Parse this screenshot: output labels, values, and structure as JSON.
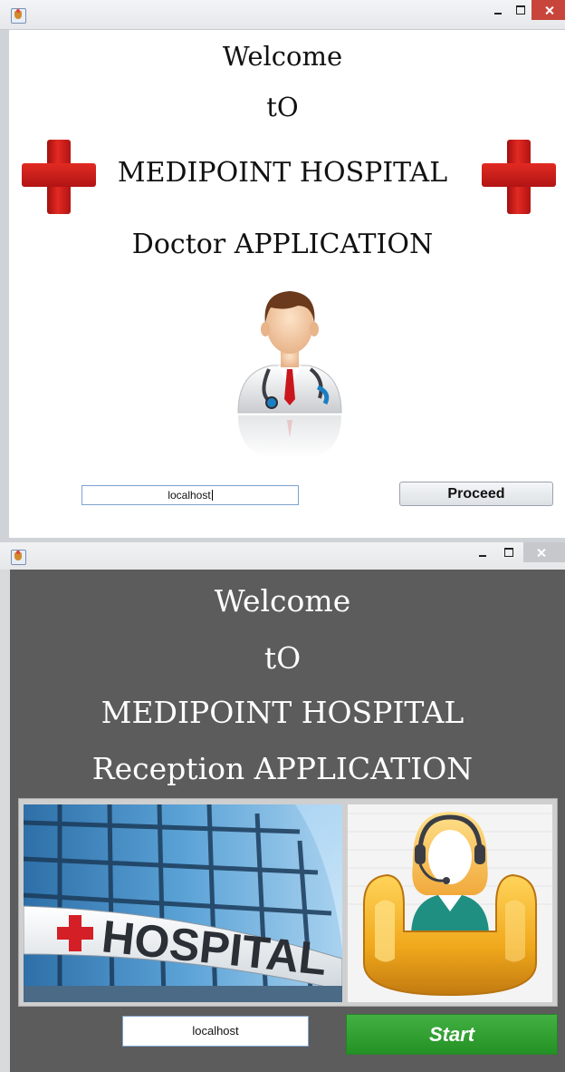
{
  "doctor_window": {
    "titlebar": {
      "app_icon": "java-cup-icon",
      "controls": [
        "minimize-icon",
        "maximize-icon",
        "close-icon"
      ]
    },
    "welcome": "Welcome",
    "to": "tO",
    "hospital_name": "MEDIPOINT HOSPITAL",
    "app_name": "Doctor APPLICATION",
    "host_input_value": "localhost",
    "proceed_label": "Proceed",
    "icons": [
      "red-cross-icon",
      "doctor-avatar-icon"
    ]
  },
  "reception_window": {
    "titlebar": {
      "app_icon": "java-cup-icon",
      "controls": [
        "minimize-icon",
        "maximize-icon",
        "close-icon"
      ]
    },
    "welcome": "Welcome",
    "to": "tO",
    "hospital_name": "MEDIPOINT HOSPITAL",
    "app_name": "Reception APPLICATION",
    "hospital_sign_text": "HOSPITAL",
    "host_input_value": "localhost",
    "start_label": "Start",
    "icons": [
      "hospital-building-image",
      "receptionist-icon"
    ]
  },
  "colors": {
    "close_active": "#c8453b",
    "reception_bg": "#5c5c5c",
    "start_button": "#2f9e2f",
    "cross_red": "#d52020"
  }
}
